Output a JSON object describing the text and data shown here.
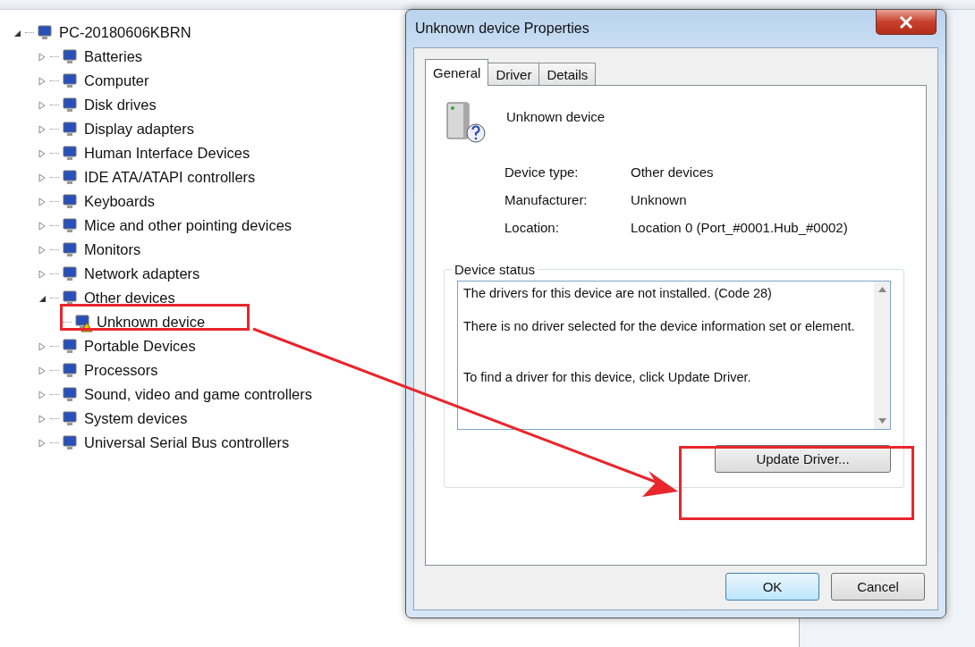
{
  "device_manager": {
    "tree": {
      "label": "PC-20180606KBRN",
      "expanded": true,
      "children": [
        {
          "label": "Batteries",
          "expanded": false
        },
        {
          "label": "Computer",
          "expanded": false
        },
        {
          "label": "Disk drives",
          "expanded": false
        },
        {
          "label": "Display adapters",
          "expanded": false
        },
        {
          "label": "Human Interface Devices",
          "expanded": false
        },
        {
          "label": "IDE ATA/ATAPI controllers",
          "expanded": false
        },
        {
          "label": "Keyboards",
          "expanded": false
        },
        {
          "label": "Mice and other pointing devices",
          "expanded": false
        },
        {
          "label": "Monitors",
          "expanded": false
        },
        {
          "label": "Network adapters",
          "expanded": false
        },
        {
          "label": "Other devices",
          "expanded": true,
          "children": [
            {
              "label": "Unknown device",
              "warning": true
            }
          ]
        },
        {
          "label": "Portable Devices",
          "expanded": false
        },
        {
          "label": "Processors",
          "expanded": false
        },
        {
          "label": "Sound, video and game controllers",
          "expanded": false
        },
        {
          "label": "System devices",
          "expanded": false
        },
        {
          "label": "Universal Serial Bus controllers",
          "expanded": false
        }
      ]
    }
  },
  "dialog": {
    "title": "Unknown device Properties",
    "tabs": [
      {
        "label": "General",
        "selected": true
      },
      {
        "label": "Driver",
        "selected": false
      },
      {
        "label": "Details",
        "selected": false
      }
    ],
    "device_name": "Unknown device",
    "properties": [
      {
        "label": "Device type:",
        "value": "Other devices"
      },
      {
        "label": "Manufacturer:",
        "value": "Unknown"
      },
      {
        "label": "Location:",
        "value": "Location 0 (Port_#0001.Hub_#0002)"
      }
    ],
    "device_status": {
      "title": "Device status",
      "paragraphs": [
        "The drivers for this device are not installed. (Code 28)",
        "There is no driver selected for the device information set or element.",
        "To find a driver for this device, click Update Driver."
      ],
      "button": "Update Driver..."
    },
    "buttons": [
      {
        "label": "OK",
        "default": true
      },
      {
        "label": "Cancel",
        "default": false
      }
    ]
  }
}
